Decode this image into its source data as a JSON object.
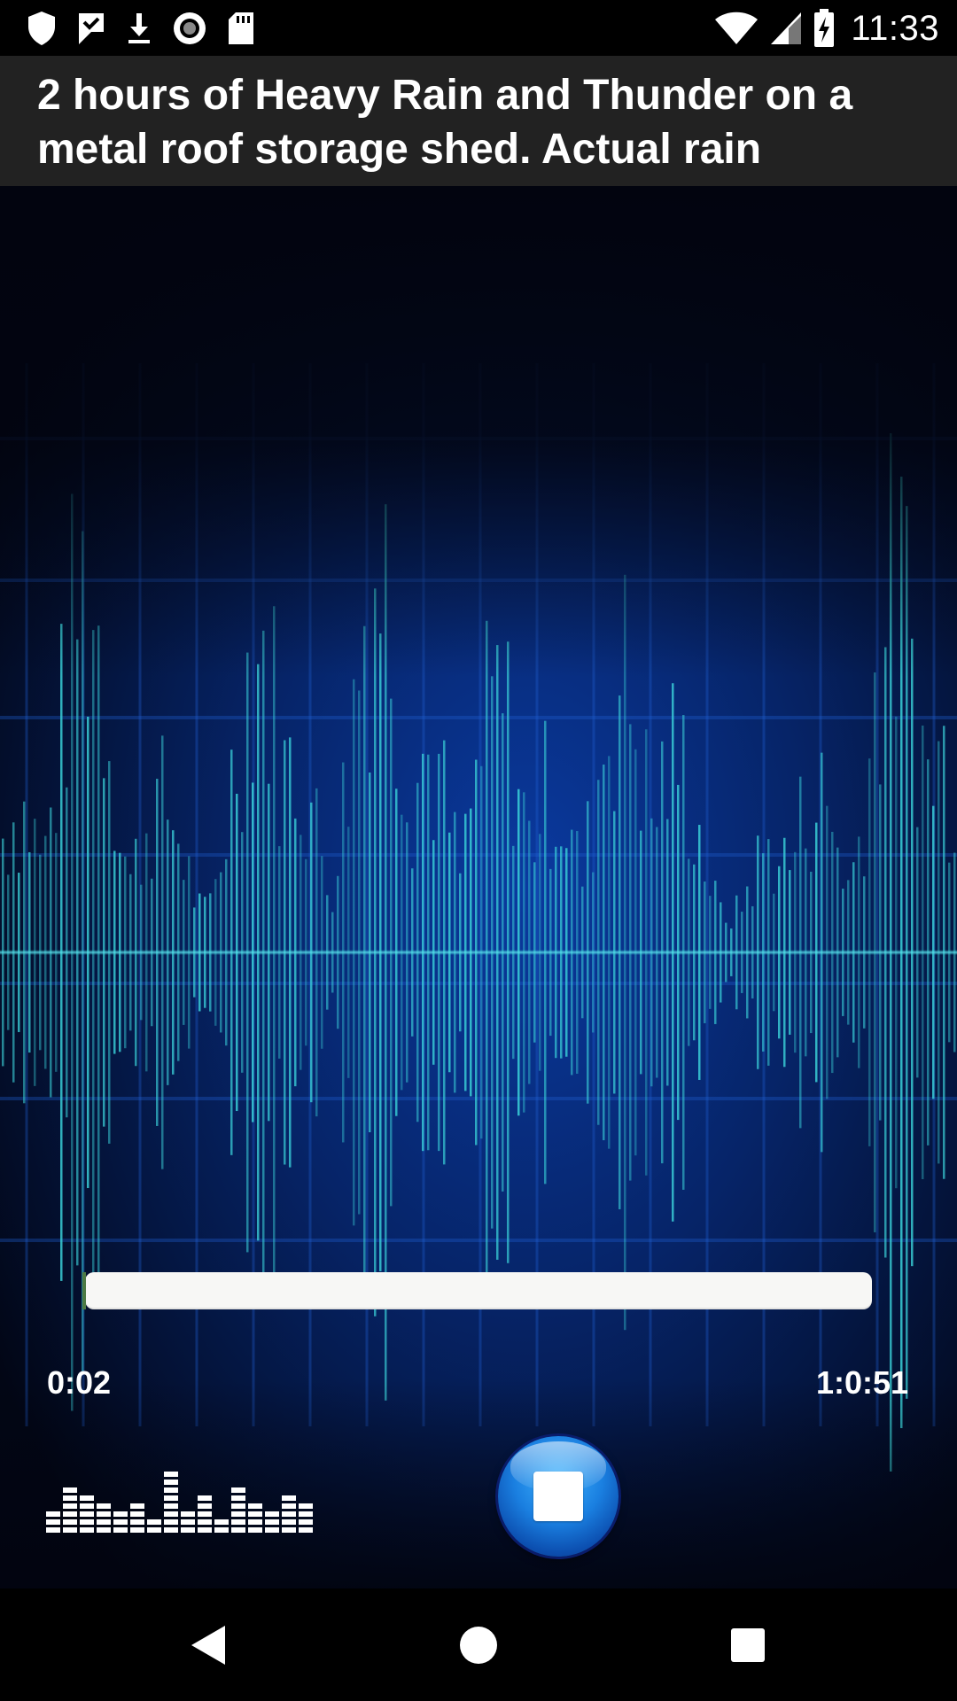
{
  "status_bar": {
    "time": "11:33",
    "left_icons": [
      "shield-icon",
      "check-flag-icon",
      "download-icon",
      "record-icon",
      "sd-card-icon"
    ],
    "right_icons": [
      "wifi-icon",
      "signal-icon",
      "battery-charging-icon"
    ]
  },
  "track": {
    "title": "2 hours of Heavy Rain and Thunder on a metal roof storage shed. Actual rain"
  },
  "player": {
    "elapsed": "0:02",
    "total": "1:0:51",
    "progress_fraction": 0.0005,
    "equalizer_icon": "equalizer-icon",
    "stop_icon": "stop-icon"
  },
  "nav_bar": {
    "buttons": [
      "back-icon",
      "home-icon",
      "recents-icon"
    ]
  },
  "colors": {
    "title_bar": "#222222",
    "seekbar": "#f7f7f5",
    "seek_progress": "#4d7a43",
    "waveform": "#3ad0d8",
    "background_glow": "#0a3aa0"
  }
}
